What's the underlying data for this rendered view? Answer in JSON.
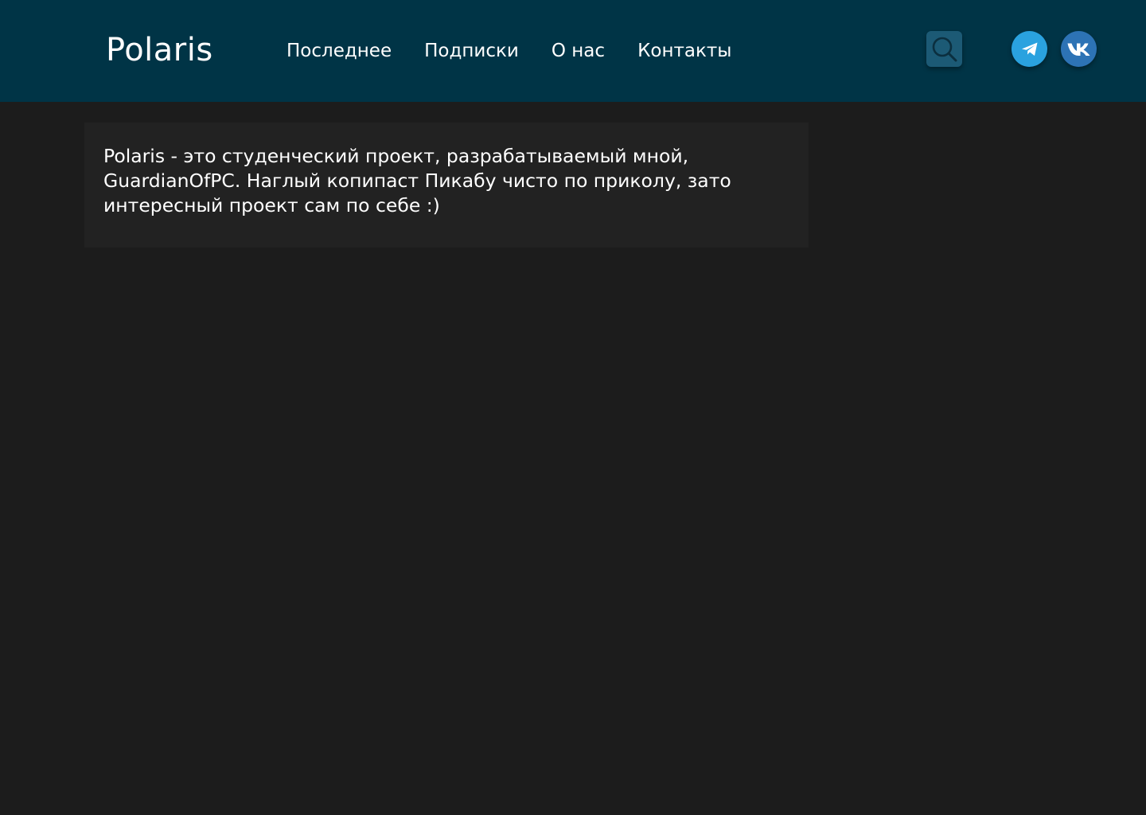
{
  "header": {
    "logo": "Polaris",
    "nav": [
      {
        "label": "Последнее"
      },
      {
        "label": "Подписки"
      },
      {
        "label": "О нас"
      },
      {
        "label": "Контакты"
      }
    ],
    "search_icon": "search-icon",
    "social": [
      {
        "icon": "telegram-icon",
        "color": "#2aa2df"
      },
      {
        "icon": "vk-icon",
        "color": "#2d73b5"
      }
    ],
    "background": "#003446"
  },
  "main": {
    "about_text": "Polaris - это студенческий проект, разрабатываемый мной, GuardianOfPC. Наглый копипаст Пикабу чисто по приколу, зато интересный проект сам по себе :)"
  },
  "colors": {
    "page_background": "#1c1c1c",
    "card_background": "#222222",
    "search_button": "#1c5a75"
  }
}
